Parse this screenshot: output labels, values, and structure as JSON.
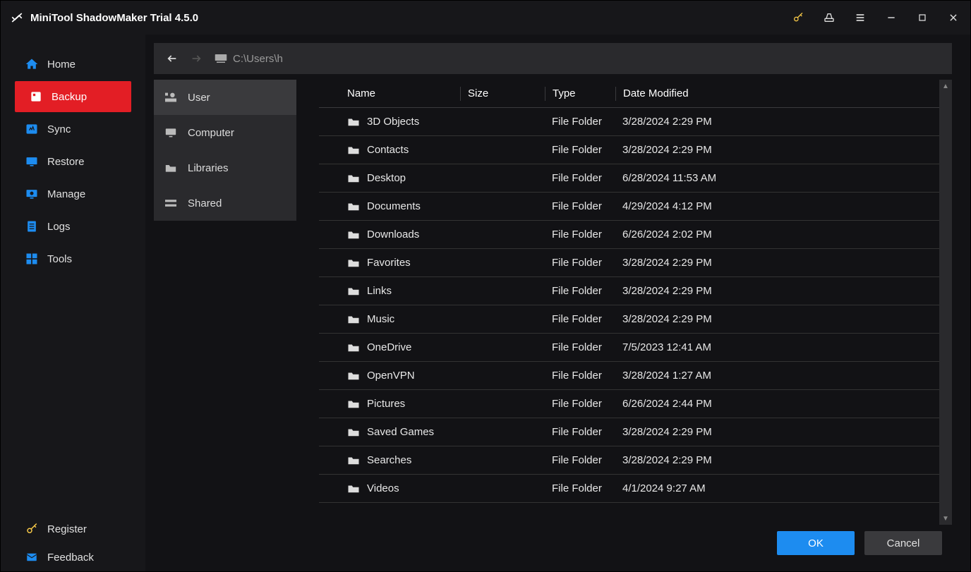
{
  "titlebar": {
    "title": "MiniTool ShadowMaker Trial 4.5.0"
  },
  "sidebar": {
    "items": [
      {
        "label": "Home",
        "icon": "home",
        "color": "#1d8cf0"
      },
      {
        "label": "Backup",
        "icon": "backup",
        "color": "#ffffff",
        "active": true
      },
      {
        "label": "Sync",
        "icon": "sync",
        "color": "#1d8cf0"
      },
      {
        "label": "Restore",
        "icon": "restore",
        "color": "#1d8cf0"
      },
      {
        "label": "Manage",
        "icon": "manage",
        "color": "#1d8cf0"
      },
      {
        "label": "Logs",
        "icon": "logs",
        "color": "#1d8cf0"
      },
      {
        "label": "Tools",
        "icon": "tools",
        "color": "#1d8cf0"
      }
    ],
    "bottom": {
      "register": "Register",
      "feedback": "Feedback"
    }
  },
  "pathbar": {
    "path": "C:\\Users\\h"
  },
  "sources": [
    {
      "label": "User",
      "icon": "user",
      "selected": true
    },
    {
      "label": "Computer",
      "icon": "computer"
    },
    {
      "label": "Libraries",
      "icon": "folder"
    },
    {
      "label": "Shared",
      "icon": "shared"
    }
  ],
  "columns": {
    "name": "Name",
    "size": "Size",
    "type": "Type",
    "date": "Date Modified"
  },
  "files": [
    {
      "name": "3D Objects",
      "type": "File Folder",
      "date": "3/28/2024 2:29 PM"
    },
    {
      "name": "Contacts",
      "type": "File Folder",
      "date": "3/28/2024 2:29 PM"
    },
    {
      "name": "Desktop",
      "type": "File Folder",
      "date": "6/28/2024 11:53 AM"
    },
    {
      "name": "Documents",
      "type": "File Folder",
      "date": "4/29/2024 4:12 PM"
    },
    {
      "name": "Downloads",
      "type": "File Folder",
      "date": "6/26/2024 2:02 PM"
    },
    {
      "name": "Favorites",
      "type": "File Folder",
      "date": "3/28/2024 2:29 PM"
    },
    {
      "name": "Links",
      "type": "File Folder",
      "date": "3/28/2024 2:29 PM"
    },
    {
      "name": "Music",
      "type": "File Folder",
      "date": "3/28/2024 2:29 PM"
    },
    {
      "name": "OneDrive",
      "type": "File Folder",
      "date": "7/5/2023 12:41 AM"
    },
    {
      "name": "OpenVPN",
      "type": "File Folder",
      "date": "3/28/2024 1:27 AM"
    },
    {
      "name": "Pictures",
      "type": "File Folder",
      "date": "6/26/2024 2:44 PM"
    },
    {
      "name": "Saved Games",
      "type": "File Folder",
      "date": "3/28/2024 2:29 PM"
    },
    {
      "name": "Searches",
      "type": "File Folder",
      "date": "3/28/2024 2:29 PM"
    },
    {
      "name": "Videos",
      "type": "File Folder",
      "date": "4/1/2024 9:27 AM"
    }
  ],
  "buttons": {
    "ok": "OK",
    "cancel": "Cancel"
  }
}
